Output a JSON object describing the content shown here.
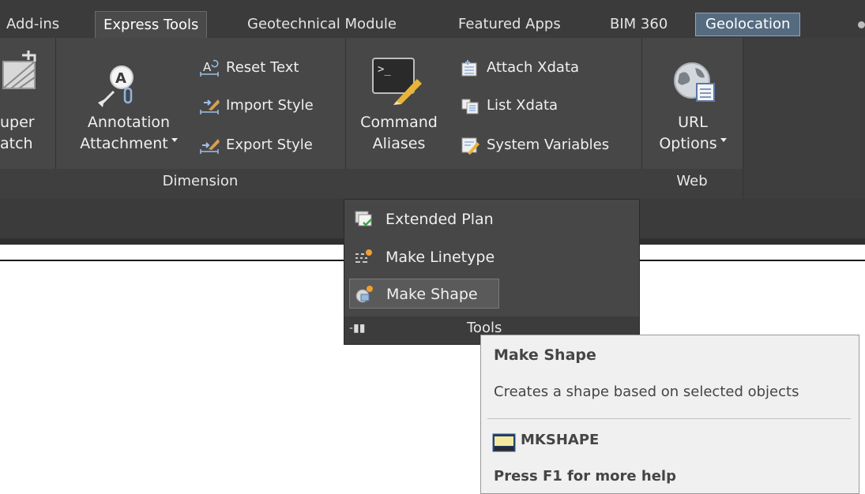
{
  "tabs": [
    {
      "label": "Add-ins"
    },
    {
      "label": "Express Tools"
    },
    {
      "label": "Geotechnical Module"
    },
    {
      "label": "Featured Apps"
    },
    {
      "label": "BIM 360"
    },
    {
      "label": "Geolocation"
    }
  ],
  "ribbon": {
    "super_match": {
      "line1": "uper",
      "line2": "atch"
    },
    "annotation": {
      "line1": "Annotation",
      "line2": "Attachment"
    },
    "reset_text": "Reset Text",
    "import_style": "Import Style",
    "export_style": "Export Style",
    "dimension_title": "Dimension",
    "command_aliases": {
      "line1": "Command",
      "line2": "Aliases"
    },
    "attach_xdata": "Attach Xdata",
    "list_xdata": "List Xdata",
    "system_variables": "System Variables",
    "url_options": {
      "line1": "URL",
      "line2": "Options"
    },
    "web_title": "Web"
  },
  "dropdown": {
    "items": [
      {
        "label": "Extended Plan"
      },
      {
        "label": "Make Linetype"
      },
      {
        "label": "Make Shape"
      }
    ],
    "footer_title": "Tools"
  },
  "tooltip": {
    "title": "Make Shape",
    "description": "Creates a shape based on selected objects",
    "command": "MKSHAPE",
    "help": "Press F1 for more help"
  },
  "colors": {
    "ribbon_bg": "#474747",
    "tab_bar_bg": "#3b3b3b",
    "geolocation_highlight": "#556b80",
    "tooltip_bg": "#f0f0f0"
  }
}
